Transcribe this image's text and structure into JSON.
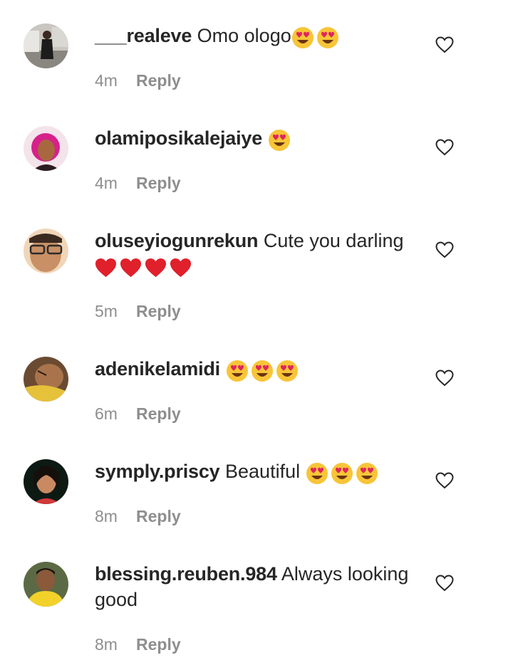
{
  "comments": [
    {
      "username": "___realeve",
      "text": "Omo ologo",
      "emoji": [
        "smiling-face-with-heart-eyes",
        "smiling-face-with-heart-eyes"
      ],
      "time": "4m",
      "reply_label": "Reply"
    },
    {
      "username": "olamiposikalejaiye",
      "text": "",
      "emoji": [
        "smiling-face-with-heart-eyes"
      ],
      "time": "4m",
      "reply_label": "Reply"
    },
    {
      "username": "oluseyiogunrekun",
      "text": "Cute you darling",
      "emoji": [
        "red-heart",
        "red-heart",
        "red-heart",
        "red-heart"
      ],
      "time": "5m",
      "reply_label": "Reply"
    },
    {
      "username": "adenikelamidi",
      "text": "",
      "emoji": [
        "smiling-face-with-heart-eyes",
        "smiling-face-with-heart-eyes",
        "smiling-face-with-heart-eyes"
      ],
      "time": "6m",
      "reply_label": "Reply"
    },
    {
      "username": "symply.priscy",
      "text": "Beautiful",
      "emoji": [
        "smiling-face-with-heart-eyes",
        "smiling-face-with-heart-eyes",
        "smiling-face-with-heart-eyes"
      ],
      "time": "8m",
      "reply_label": "Reply"
    },
    {
      "username": "blessing.reuben.984",
      "text": "Always looking good",
      "emoji": [],
      "time": "8m",
      "reply_label": "Reply"
    }
  ],
  "icons": {
    "like": "heart-outline-icon"
  },
  "colors": {
    "text": "#262626",
    "meta": "#8e8e8e",
    "heart_emoji": "#e0202a",
    "emoji_face": "#f7c538"
  }
}
